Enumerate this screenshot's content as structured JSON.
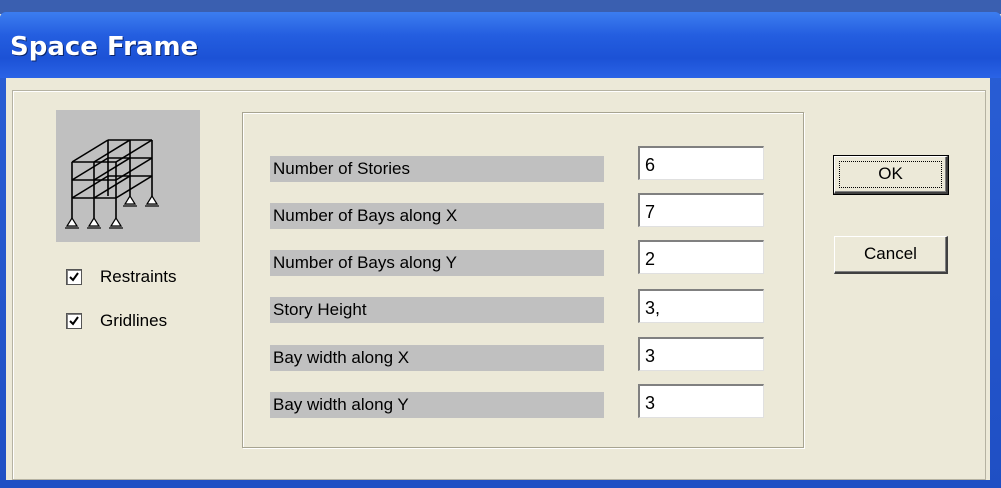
{
  "window": {
    "title": "Space Frame"
  },
  "options": [
    {
      "label": "Restraints",
      "checked": true
    },
    {
      "label": "Gridlines",
      "checked": true
    }
  ],
  "fields": [
    {
      "label": "Number of Stories",
      "value": "6"
    },
    {
      "label": "Number of Bays along X",
      "value": "7"
    },
    {
      "label": "Number of Bays along Y",
      "value": "2"
    },
    {
      "label": "Story Height",
      "value": "3,"
    },
    {
      "label": "Bay width along X",
      "value": "3"
    },
    {
      "label": "Bay width along Y",
      "value": "3"
    }
  ],
  "buttons": {
    "ok": "OK",
    "cancel": "Cancel"
  },
  "icons": [
    "space-frame-preview-icon",
    "checkmark-icon"
  ]
}
